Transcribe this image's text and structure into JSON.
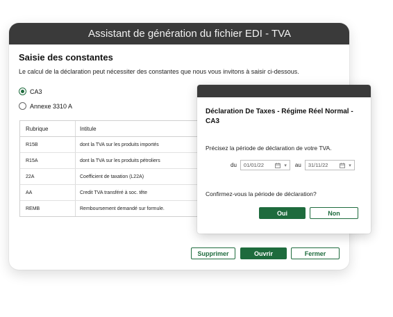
{
  "main_window": {
    "title": "Assistant de génération du fichier EDI - TVA",
    "section_title": "Saisie des constantes",
    "intro": "Le calcul de la déclaration peut nécessiter des constantes que nous vous invitons à saisir ci-dessous.",
    "options": [
      {
        "label": "CA3",
        "selected": true
      },
      {
        "label": "Annexe 3310 A",
        "selected": false
      }
    ],
    "table": {
      "headers": [
        "Rubrique",
        "Intitule"
      ],
      "rows": [
        [
          "R15B",
          "dont la TVA sur les produits importés"
        ],
        [
          "R15A",
          "dont la TVA sur les produits pétroliers"
        ],
        [
          "22A",
          "Coefficient de taxation (L22A)"
        ],
        [
          "AA",
          "Credit TVA transféré à soc. tête"
        ],
        [
          "REMB",
          "Remboursement demandé sur formule."
        ]
      ]
    },
    "buttons": {
      "delete": "Supprimer",
      "open": "Ouvrir",
      "close": "Fermer"
    }
  },
  "dialog": {
    "title": "Déclaration De Taxes - Régime Réel Normal - CA3",
    "prompt": "Précisez la période de déclaration de votre TVA.",
    "from_label": "du",
    "from_date": "01/01/22",
    "to_label": "au",
    "to_date": "31/11/22",
    "confirm": "Confirmez-vous la période de déclaration?",
    "yes": "Oui",
    "no": "Non"
  },
  "colors": {
    "accent": "#1e6b3d",
    "titlebar": "#3a3a3a"
  },
  "icons": [
    "calendar-icon",
    "chevron-down-icon"
  ]
}
